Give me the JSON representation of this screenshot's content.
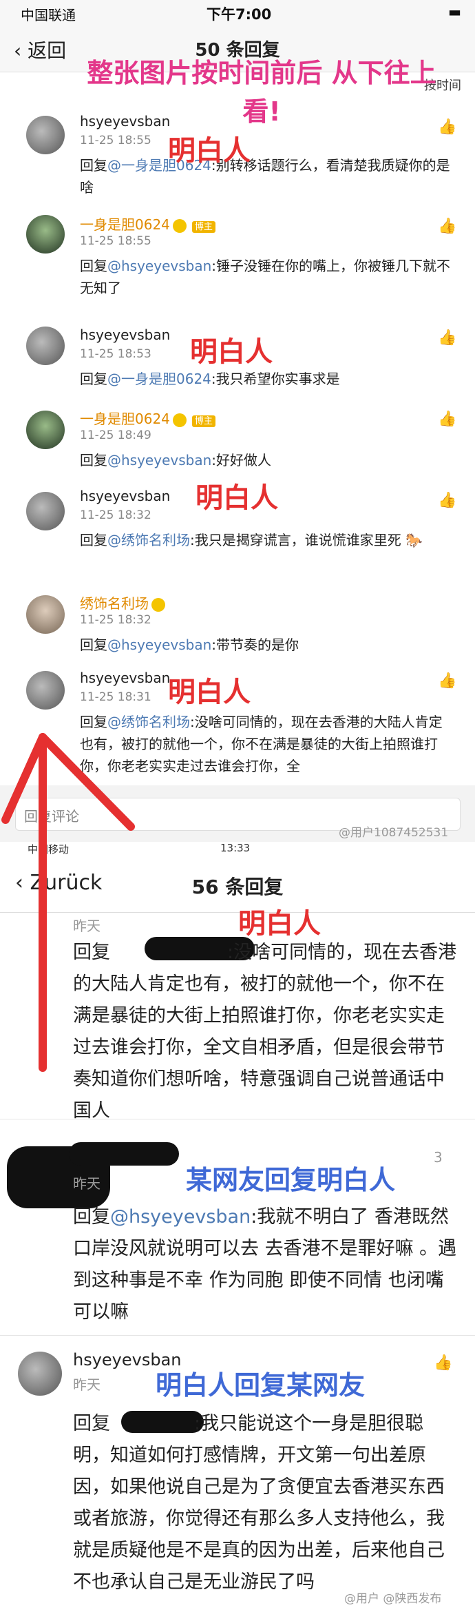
{
  "status": {
    "carrier": "中国联通",
    "time": "下午7:00",
    "battery": "▮"
  },
  "nav": {
    "back": "返回",
    "title": "50 条回复",
    "sort": "按时间"
  },
  "comments": [
    {
      "user": "hsyeyevsban",
      "time": "11-25 18:55",
      "reply_prefix": "回复",
      "mention": "@一身是胆0624",
      "text": ":别转移话题行么，看清楚我质疑你的是啥",
      "annotation": "明白人"
    },
    {
      "user": "一身是胆0624",
      "badge": "博主",
      "time": "11-25 18:55",
      "reply_prefix": "回复",
      "mention": "@hsyeyevsban",
      "text": ":锤子没锤在你的嘴上，你被锤几下就不无知了"
    },
    {
      "user": "hsyeyevsban",
      "time": "11-25 18:53",
      "reply_prefix": "回复",
      "mention": "@一身是胆0624",
      "text": ":我只希望你实事求是",
      "annotation": "明白人"
    },
    {
      "user": "一身是胆0624",
      "badge": "博主",
      "time": "11-25 18:49",
      "reply_prefix": "回复",
      "mention": "@hsyeyevsban",
      "text": ":好好做人"
    },
    {
      "user": "hsyeyevsban",
      "time": "11-25 18:32",
      "reply_prefix": "回复",
      "mention": "@绣饰名利场",
      "text": ":我只是揭穿谎言，谁说慌谁家里死",
      "annotation": "明白人"
    },
    {
      "user": "绣饰名利场",
      "time": "11-25 18:32",
      "reply_prefix": "回复",
      "mention": "@hsyeyevsban",
      "text": ":带节奏的是你"
    },
    {
      "user": "hsyeyevsban",
      "time": "11-25 18:31",
      "reply_prefix": "回复",
      "mention": "@绣饰名利场",
      "text": ":没啥可同情的，现在去香港的大陆人肯定也有，被打的就他一个，你不在满是暴徒的大街上拍照谁打你，你老老实实走过去谁会打你，全",
      "annotation": "明白人"
    }
  ],
  "reply_placeholder": "回复评论",
  "watermark1": "@用户1087452531",
  "annotation_top": "整张图片按时间前后 从下往上看!",
  "screen2": {
    "carrier": "中国移动",
    "time": "13:33",
    "back": "Zurück",
    "title": "56 条回复",
    "c1": {
      "time": "昨天",
      "reply_prefix": "回复",
      "text": ":没啥可同情的，现在去香港的大陆人肯定也有，被打的就他一个，你不在满是暴徒的大街上拍照谁打你，你老老实实走过去谁会打你，全文自相矛盾，但是很会带节奏知道你们想听啥，特意强调自己说普通话中国人",
      "annotation": "明白人"
    },
    "c2": {
      "time": "昨天",
      "reply_prefix": "回复",
      "mention": "@hsyeyevsban",
      "text": ":我就不明白了 香港既然口岸没风就说明可以去 去香港不是罪好嘛 。遇到这种事是不幸 作为同胞 即使不同情 也闭嘴可以嘛",
      "annotation": "某网友回复明白人",
      "likes": "3"
    },
    "c3": {
      "user": "hsyeyevsban",
      "time": "昨天",
      "reply_prefix": "回复",
      "text": ":我只能说这个一身是胆很聪明，知道如何打感情牌，开文第一句出差原因，如果他说自己是为了贪便宜去香港买东西或者旅游，你觉得还有那么多人支持他么，我就是质疑他是不是真的因为出差，后来他自己不也承认自己是无业游民了吗",
      "annotation": "明白人回复某网友"
    },
    "watermark2": "@用户",
    "watermark3": "@陕西发布"
  }
}
